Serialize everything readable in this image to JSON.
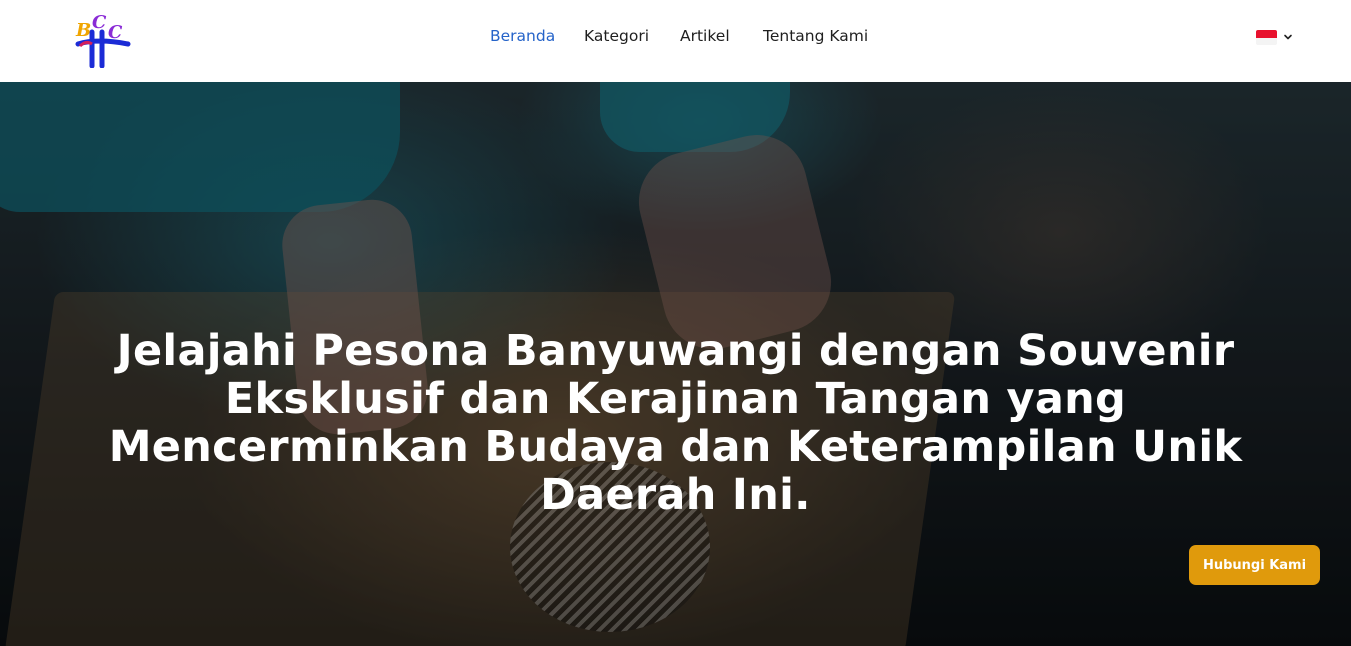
{
  "logo": {
    "text": "BCC"
  },
  "nav": {
    "items": [
      {
        "label": "Beranda",
        "active": true
      },
      {
        "label": "Kategori",
        "active": false
      },
      {
        "label": "Artikel",
        "active": false
      },
      {
        "label": "Tentang Kami",
        "active": false
      }
    ],
    "language": {
      "flag": "indonesia-flag-icon",
      "icon": "chevron-down-icon"
    }
  },
  "hero": {
    "title": "Jelajahi Pesona Banyuwangi dengan Souvenir Eksklusif dan Kerajinan Tangan yang Mencerminkan Budaya dan Keterampilan Unik Daerah Ini.",
    "cta_label": "Hubungi Kami"
  },
  "colors": {
    "nav_active": "#2563c9",
    "cta": "#e09a0c",
    "logo_blue": "#1b2bd6",
    "logo_orange": "#f0a500",
    "logo_purple": "#8a2bd6"
  }
}
